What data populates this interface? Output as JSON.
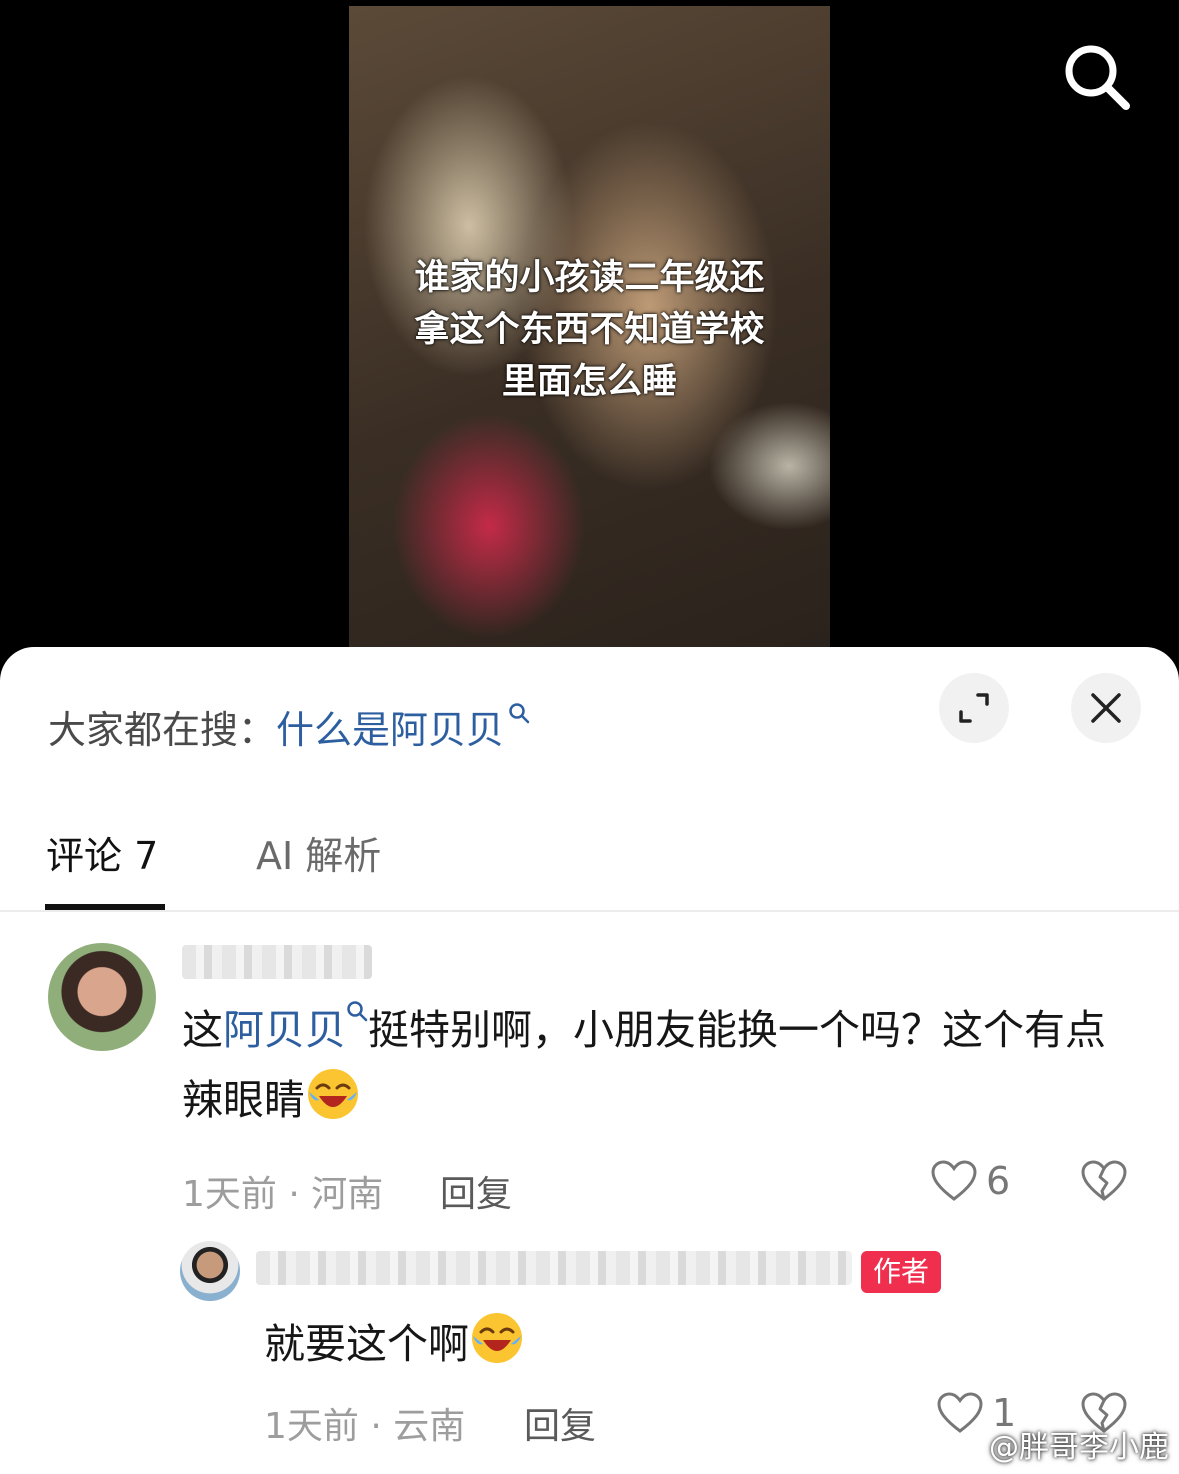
{
  "video": {
    "caption_lines": [
      "谁家的小孩读二年级还",
      "拿这个东西不知道学校",
      "里面怎么睡"
    ]
  },
  "sheet": {
    "suggest_prefix": "大家都在搜：",
    "suggest_query": "什么是阿贝贝"
  },
  "tabs": [
    {
      "label": "评论 7"
    },
    {
      "label": "AI 解析"
    }
  ],
  "comments": [
    {
      "text_before": "这",
      "text_link": "阿贝贝",
      "text_after": "挺特别啊，小朋友能换一个吗？这个有点辣眼睛",
      "time_location": "1天前 · 河南",
      "reply_label": "回复",
      "likes": "6",
      "emoji": "laugh-cry-emoji"
    },
    {
      "badge": "作者",
      "text": "就要这个啊",
      "time_location": "1天前 · 云南",
      "reply_label": "回复",
      "likes": "1",
      "emoji": "laugh-cry-emoji"
    }
  ],
  "watermark": "@胖哥李小鹿",
  "colors": {
    "link": "#2d5fa0",
    "badge": "#f02f4f",
    "meta": "#9d9d9d"
  },
  "icons": [
    "search-icon",
    "expand-icon",
    "close-icon",
    "heart-icon",
    "broken-heart-icon",
    "weibo-logo-icon"
  ]
}
